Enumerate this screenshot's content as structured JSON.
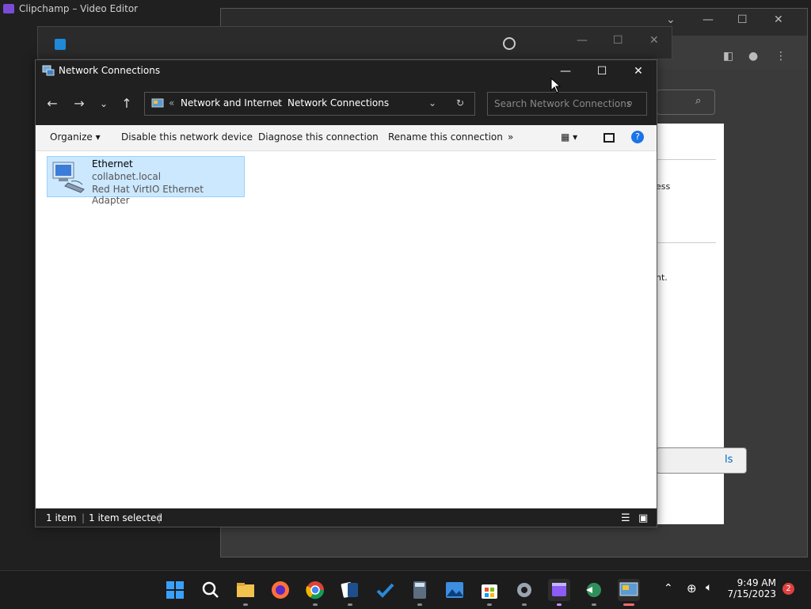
{
  "background_app": {
    "title": "Clipchamp – Video Editor"
  },
  "settings_fragments": {
    "text1": "ess",
    "text2": "nt.",
    "button": "ls"
  },
  "explorer": {
    "title": "Network Connections",
    "breadcrumb": {
      "sep_start": "«",
      "part1": "Network and Internet",
      "arrow": "›",
      "part2": "Network Connections"
    },
    "search_placeholder": "Search Network Connections",
    "commands": {
      "organize": "Organize",
      "disable": "Disable this network device",
      "diagnose": "Diagnose this connection",
      "rename": "Rename this connection",
      "more": "»"
    },
    "items": [
      {
        "name": "Ethernet",
        "domain": "collabnet.local",
        "adapter": "Red Hat VirtIO Ethernet Adapter"
      }
    ],
    "status": {
      "count": "1 item",
      "selected": "1 item selected"
    }
  },
  "taskbar": {
    "time": "9:49 AM",
    "date": "7/15/2023",
    "notifications": "2",
    "apps": [
      "windows-start-icon",
      "search-icon",
      "file-explorer-icon",
      "firefox-icon",
      "chrome-icon",
      "solitaire-icon",
      "todo-icon",
      "calculator-icon",
      "photos-icon",
      "store-icon",
      "settings-icon",
      "clipchamp-icon",
      "network-icon",
      "control-panel-icon"
    ]
  },
  "colors": {
    "selection": "#cce8ff",
    "accent": "#0067c0",
    "titlebar": "#202020"
  }
}
